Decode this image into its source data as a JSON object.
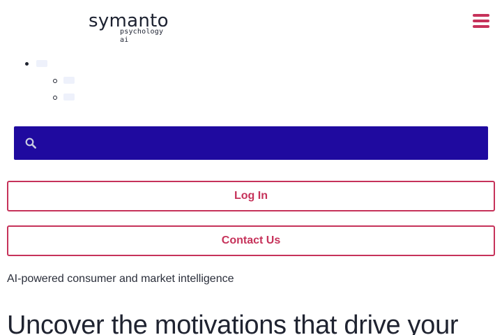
{
  "header": {
    "logo_word": "symanto",
    "logo_sub": "psychology ai",
    "menu_icon": "hamburger-icon"
  },
  "search": {
    "icon": "search-icon",
    "placeholder": "",
    "value": ""
  },
  "buttons": {
    "login": "Log In",
    "contact": "Contact Us"
  },
  "hero": {
    "tagline": "AI-powered consumer and market intelligence",
    "headline": "Uncover the motivations that drive your"
  },
  "colors": {
    "accent": "#c6325a",
    "search_bg": "#1f0a9f",
    "text": "#1f2330"
  }
}
